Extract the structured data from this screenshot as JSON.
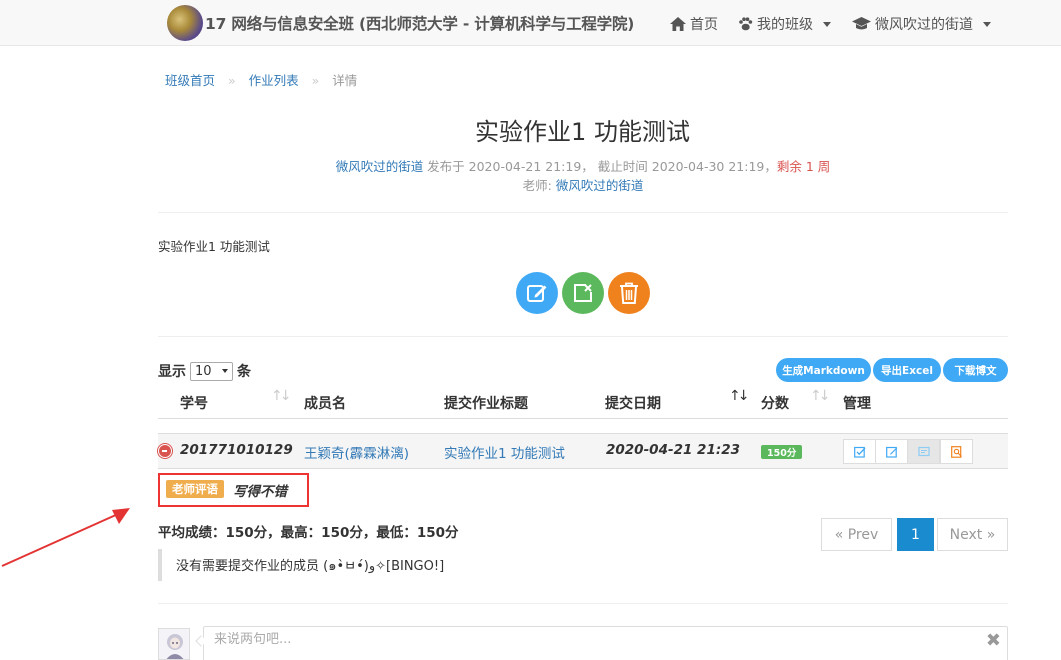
{
  "navbar": {
    "title": "17 网络与信息安全班 (西北师范大学 - 计算机科学与工程学院)",
    "home": "首页",
    "my_class": "我的班级",
    "user": "微风吹过的街道"
  },
  "breadcrumb": {
    "home": "班级首页",
    "sep": "»",
    "list": "作业列表",
    "current": "详情"
  },
  "homework": {
    "title": "实验作业1 功能测试",
    "author": "微风吹过的街道",
    "published_prefix": " 发布于 2020-04-21 21:19， 截止时间 2020-04-30 21:19，",
    "remaining": "剩余 1 周",
    "teacher_prefix": "老师: ",
    "teacher": "微风吹过的街道",
    "description": "实验作业1 功能测试"
  },
  "table_controls": {
    "show_label": "显示",
    "page_size": "10",
    "unit": "条",
    "btn_markdown": "生成Markdown",
    "btn_excel": "导出Excel",
    "btn_download": "下载博文"
  },
  "table": {
    "headers": [
      "学号",
      "成员名",
      "提交作业标题",
      "提交日期",
      "分数",
      "管理"
    ],
    "sort_icon": "↑↓",
    "rows": [
      {
        "student_id": "201771010129",
        "name": "王颖奇(霹霖淋漓)",
        "title": "实验作业1 功能测试",
        "date": "2020-04-21 21:23",
        "score": "150分"
      }
    ]
  },
  "comment": {
    "tag": "老师评语",
    "text": "写得不错"
  },
  "stats": "平均成绩：150分，最高：150分，最低：150分",
  "pagination": {
    "prev": "« Prev",
    "current": "1",
    "next": "Next »"
  },
  "notice": "没有需要提交作业的成员 (๑•̀ㅂ•́)و✧[BINGO!]",
  "comment_input": {
    "placeholder": "来说两句吧...",
    "close": "✖"
  },
  "colors": {
    "link": "#337ab7",
    "edit_btn": "#3fa9f5",
    "close_btn": "#5cb85c",
    "delete_btn": "#f0821e",
    "danger": "#d9534f",
    "annotation": "#e33333"
  }
}
